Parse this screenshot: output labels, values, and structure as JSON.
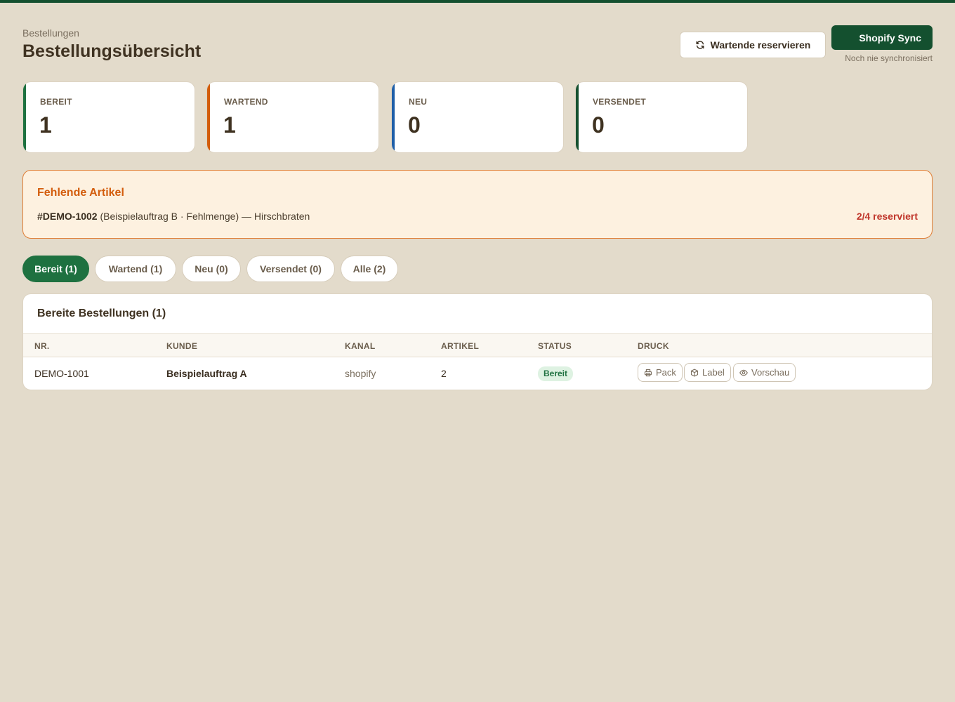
{
  "header": {
    "breadcrumb": "Bestellungen",
    "title": "Bestellungsübersicht",
    "reserve_button": "Wartende reservieren",
    "sync_button": "Shopify Sync",
    "sync_status": "Noch nie synchronisiert"
  },
  "stats": [
    {
      "label": "BEREIT",
      "value": "1",
      "color": "#1e7140"
    },
    {
      "label": "WARTEND",
      "value": "1",
      "color": "#d35d0d"
    },
    {
      "label": "NEU",
      "value": "0",
      "color": "#1f5fa8"
    },
    {
      "label": "VERSENDET",
      "value": "0",
      "color": "#14502f"
    }
  ],
  "alert": {
    "title": "Fehlende Artikel",
    "order": "#DEMO-1002",
    "detail": "(Beispielauftrag B · Fehlmenge) — Hirschbraten",
    "status": "2/4 reserviert"
  },
  "tabs": [
    {
      "label": "Bereit (1)",
      "active": true
    },
    {
      "label": "Wartend (1)",
      "active": false
    },
    {
      "label": "Neu (0)",
      "active": false
    },
    {
      "label": "Versendet (0)",
      "active": false
    },
    {
      "label": "Alle (2)",
      "active": false
    }
  ],
  "table": {
    "title": "Bereite Bestellungen (1)",
    "columns": [
      "NR.",
      "KUNDE",
      "KANAL",
      "ARTIKEL",
      "STATUS",
      "DRUCK"
    ],
    "rows": [
      {
        "nr": "DEMO-1001",
        "kunde": "Beispielauftrag A",
        "kanal": "shopify",
        "artikel": "2",
        "status": "Bereit",
        "actions": {
          "pack": "Pack",
          "label": "Label",
          "preview": "Vorschau"
        }
      }
    ]
  },
  "icons": {
    "reserve": "refresh-icon",
    "pack": "printer-icon",
    "label": "box-icon",
    "preview": "eye-icon"
  }
}
